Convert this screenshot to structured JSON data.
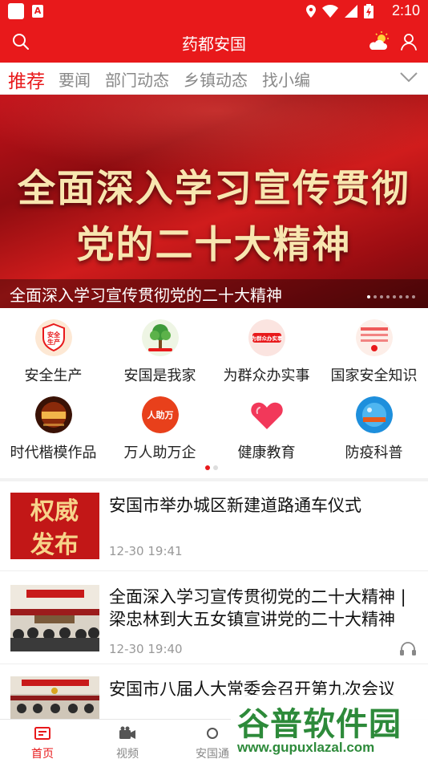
{
  "status_bar": {
    "time": "2:10"
  },
  "app_bar": {
    "title": "药都安国"
  },
  "tabs": [
    {
      "label": "推荐",
      "active": true
    },
    {
      "label": "要闻",
      "active": false
    },
    {
      "label": "部门动态",
      "active": false
    },
    {
      "label": "乡镇动态",
      "active": false
    },
    {
      "label": "找小编",
      "active": false
    }
  ],
  "banner": {
    "headline_line1": "全面深入学习宣传贯彻",
    "headline_line2": "党的二十大精神",
    "caption": "全面深入学习宣传贯彻党的二十大精神",
    "slide_count": 8,
    "active_slide": 1
  },
  "shortcuts": [
    {
      "label": "安全生产",
      "icon": "safety-production-icon",
      "icon_text": "安全生产"
    },
    {
      "label": "安国是我家",
      "icon": "anguo-home-icon",
      "icon_text": ""
    },
    {
      "label": "为群众办实事",
      "icon": "serve-people-icon",
      "icon_text": "为群众办实事"
    },
    {
      "label": "国家安全知识",
      "icon": "national-security-icon",
      "icon_text": ""
    },
    {
      "label": "时代楷模作品",
      "icon": "role-model-icon",
      "icon_text": ""
    },
    {
      "label": "万人助万企",
      "icon": "help-enterprises-icon",
      "icon_text": "人助万"
    },
    {
      "label": "健康教育",
      "icon": "heart-icon",
      "icon_text": ""
    },
    {
      "label": "防疫科普",
      "icon": "epidemic-science-icon",
      "icon_text": ""
    }
  ],
  "news": [
    {
      "title": "安国市举办城区新建道路通车仪式",
      "time": "12-30 19:41",
      "thumb": "权威发布",
      "thumb_line1": "权威",
      "thumb_line2": "发布",
      "has_audio": false
    },
    {
      "title": "全面深入学习宣传贯彻党的二十大精神 | 梁忠林到大五女镇宣讲党的二十大精神",
      "time": "12-30 19:40",
      "thumb": "meeting-photo",
      "has_audio": true
    },
    {
      "title": "安国市八届人大常委会召开第九次会议",
      "time": "",
      "thumb": "meeting-photo-2",
      "has_audio": false
    }
  ],
  "bottom_nav": [
    {
      "label": "首页",
      "icon": "home-icon",
      "active": true
    },
    {
      "label": "视频",
      "icon": "video-camera-icon",
      "active": false
    },
    {
      "label": "安国通",
      "icon": "circle-icon",
      "active": false
    }
  ],
  "watermark": {
    "line1": "谷普软件园",
    "line2": "www.gupuxlazal.com"
  },
  "colors": {
    "brand_red": "#e8191b",
    "tab_inactive": "#888888",
    "text": "#111111",
    "meta": "#999999"
  }
}
